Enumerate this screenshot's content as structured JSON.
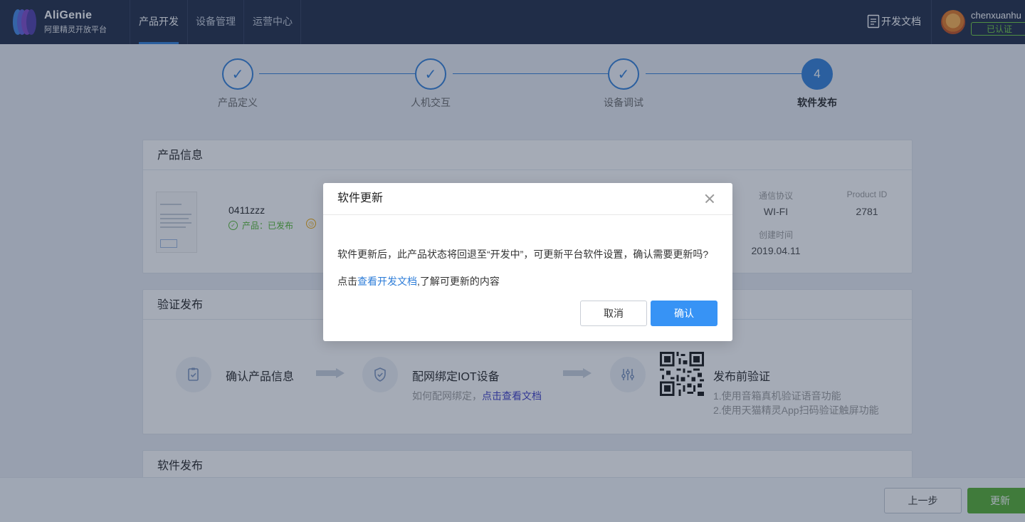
{
  "header": {
    "brand_title": "AliGenie",
    "brand_subtitle": "阿里精灵开放平台",
    "nav": [
      {
        "label": "产品开发",
        "active": true
      },
      {
        "label": "设备管理",
        "active": false
      },
      {
        "label": "运营中心",
        "active": false
      }
    ],
    "docs_label": "开发文档",
    "user_name": "chenxuanhu",
    "user_badge": "已认证"
  },
  "steps": [
    {
      "label": "产品定义",
      "mark": "✓",
      "done": true
    },
    {
      "label": "人机交互",
      "mark": "✓",
      "done": true
    },
    {
      "label": "设备调试",
      "mark": "✓",
      "done": true
    },
    {
      "label": "软件发布",
      "mark": "4",
      "done": false
    }
  ],
  "product_info": {
    "title": "产品信息",
    "name": "0411zzz",
    "status": "产品：已发布",
    "fields": [
      {
        "label": "通信协议",
        "value": "WI-FI"
      },
      {
        "label": "Product ID",
        "value": "2781"
      },
      {
        "label": "创建时间",
        "value": "2019.04.11"
      }
    ]
  },
  "verify": {
    "title": "验证发布",
    "step1_title": "确认产品信息",
    "step2_title": "配网绑定IOT设备",
    "step2_sub": "如何配网绑定，",
    "step2_link": "点击查看文档",
    "step3_title": "发布前验证",
    "step3_line1": "1.使用音箱真机验证语音功能",
    "step3_line2": "2.使用天猫精灵App扫码验证触屏功能"
  },
  "release": {
    "title": "软件发布"
  },
  "footer": {
    "prev_label": "上一步",
    "update_label": "更新"
  },
  "modal": {
    "title": "软件更新",
    "message": "软件更新后，此产品状态将回退至“开发中”，可更新平台软件设置，确认需要更新吗?",
    "hint_prefix": "点击",
    "hint_link": "查看开发文档",
    "hint_suffix": ",了解可更新的内容",
    "cancel_label": "取消",
    "confirm_label": "确认"
  },
  "colors": {
    "brand_blue": "#2e7dd8",
    "header_bg": "#1b2742",
    "success_green": "#52ad2b",
    "primary_button": "#3793f5"
  }
}
